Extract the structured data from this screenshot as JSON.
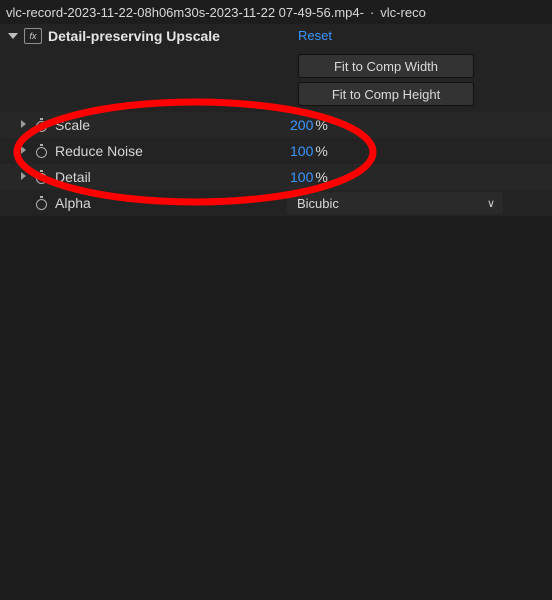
{
  "tabs": {
    "active": "vlc-record-2023-11-22-08h06m30s-2023-11-22 07-49-56.mp4-",
    "next_partial": "vlc-reco"
  },
  "effect": {
    "name": "Detail-preserving Upscale",
    "reset_label": "Reset",
    "fit_width_label": "Fit to Comp Width",
    "fit_height_label": "Fit to Comp Height"
  },
  "props": {
    "scale": {
      "label": "Scale",
      "value": "200",
      "unit": "%"
    },
    "reduce_noise": {
      "label": "Reduce Noise",
      "value": "100",
      "unit": "%"
    },
    "detail": {
      "label": "Detail",
      "value": "100",
      "unit": "%"
    },
    "alpha": {
      "label": "Alpha",
      "selected": "Bicubic"
    }
  }
}
